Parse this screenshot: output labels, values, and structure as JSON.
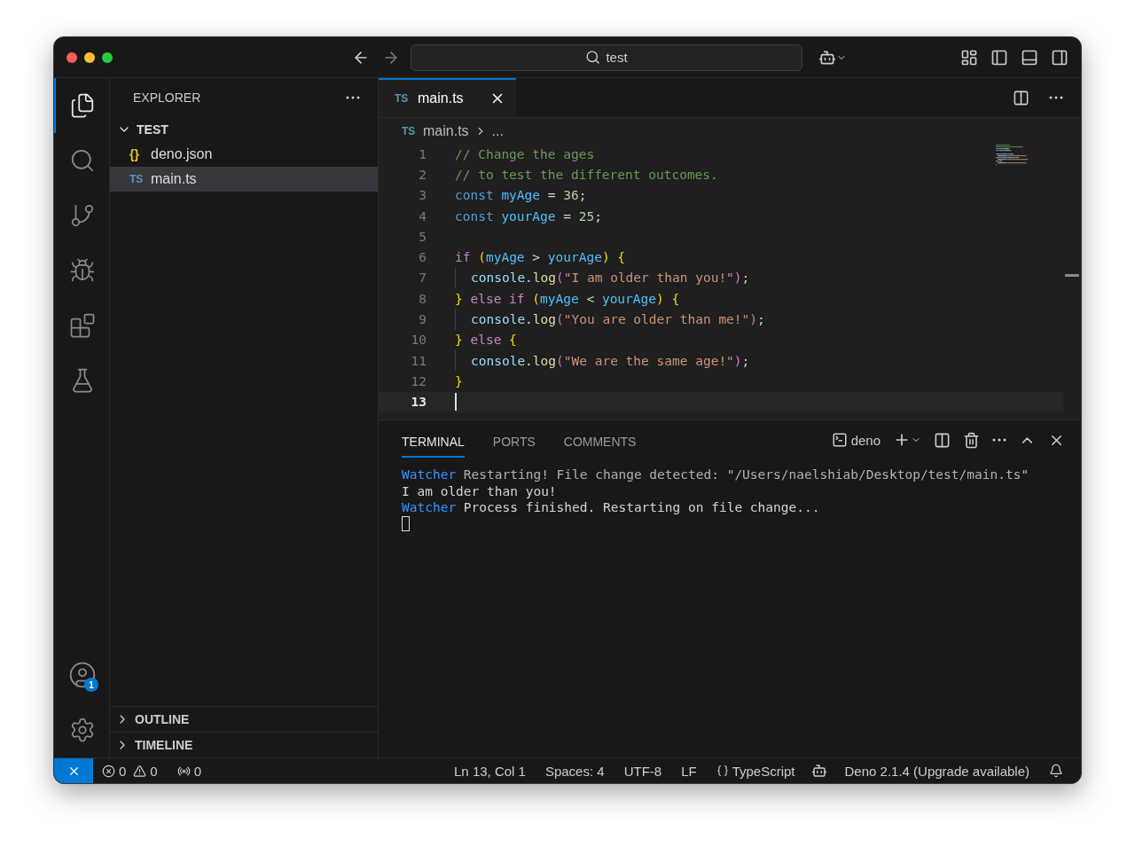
{
  "titlebar": {
    "search": "test"
  },
  "activity_bar": {
    "items": [
      {
        "kind": "files",
        "selected": true
      },
      {
        "kind": "search",
        "selected": false
      },
      {
        "kind": "source-control",
        "selected": false
      },
      {
        "kind": "run-debug",
        "selected": false
      },
      {
        "kind": "extensions",
        "selected": false
      },
      {
        "kind": "testing",
        "selected": false
      }
    ],
    "account_badge": "1"
  },
  "sidebar": {
    "title": "EXPLORER",
    "folder": {
      "name": "TEST",
      "expanded": true,
      "children": [
        {
          "name": "deno.json",
          "kind": "json",
          "icon_text": "{}",
          "selected": false
        },
        {
          "name": "main.ts",
          "kind": "ts",
          "icon_text": "TS",
          "selected": true
        }
      ]
    },
    "sections": [
      {
        "name": "OUTLINE",
        "expanded": false
      },
      {
        "name": "TIMELINE",
        "expanded": false
      }
    ]
  },
  "editor": {
    "tabs": [
      {
        "label": "main.ts",
        "icon_text": "TS",
        "selected": true
      }
    ],
    "breadcrumb": {
      "icon_text": "TS",
      "file": "main.ts",
      "rest": "..."
    },
    "lines": [
      {
        "number": "1",
        "indent": false,
        "current": false,
        "tokens": [
          {
            "kind": "comment",
            "text": "// Change the ages"
          }
        ]
      },
      {
        "number": "2",
        "indent": false,
        "current": false,
        "tokens": [
          {
            "kind": "comment",
            "text": "// to test the different outcomes."
          }
        ]
      },
      {
        "number": "3",
        "indent": false,
        "current": false,
        "tokens": [
          {
            "kind": "keyword",
            "text": "const"
          },
          {
            "kind": "variable",
            "text": " myAge"
          },
          {
            "kind": "plain",
            "text": " = "
          },
          {
            "kind": "number",
            "text": "36"
          },
          {
            "kind": "plain",
            "text": ";"
          }
        ]
      },
      {
        "number": "4",
        "indent": false,
        "current": false,
        "tokens": [
          {
            "kind": "keyword",
            "text": "const"
          },
          {
            "kind": "variable",
            "text": " yourAge"
          },
          {
            "kind": "plain",
            "text": " = "
          },
          {
            "kind": "number",
            "text": "25"
          },
          {
            "kind": "plain",
            "text": ";"
          }
        ]
      },
      {
        "number": "5",
        "indent": false,
        "current": false
      },
      {
        "number": "6",
        "indent": false,
        "current": false,
        "tokens": [
          {
            "kind": "control",
            "text": "if"
          },
          {
            "kind": "bracket",
            "text": " ("
          },
          {
            "kind": "variable",
            "text": "myAge"
          },
          {
            "kind": "plain",
            "text": " > "
          },
          {
            "kind": "variable",
            "text": "yourAge"
          },
          {
            "kind": "bracket",
            "text": ")"
          },
          {
            "kind": "bracket",
            "text": " {"
          }
        ]
      },
      {
        "number": "7",
        "indent": true,
        "current": false,
        "tokens": [
          {
            "kind": "object",
            "text": "console"
          },
          {
            "kind": "plain",
            "text": "."
          },
          {
            "kind": "function",
            "text": "log"
          },
          {
            "kind": "bracket2",
            "text": "("
          },
          {
            "kind": "string",
            "text": "\"I am older than you!\""
          },
          {
            "kind": "bracket2",
            "text": ")"
          },
          {
            "kind": "plain",
            "text": ";"
          }
        ]
      },
      {
        "number": "8",
        "indent": false,
        "current": false,
        "tokens": [
          {
            "kind": "bracket",
            "text": "}"
          },
          {
            "kind": "control",
            "text": " else if"
          },
          {
            "kind": "bracket",
            "text": " ("
          },
          {
            "kind": "variable",
            "text": "myAge"
          },
          {
            "kind": "plain",
            "text": " < "
          },
          {
            "kind": "variable",
            "text": "yourAge"
          },
          {
            "kind": "bracket",
            "text": ")"
          },
          {
            "kind": "bracket",
            "text": " {"
          }
        ]
      },
      {
        "number": "9",
        "indent": true,
        "current": false,
        "tokens": [
          {
            "kind": "object",
            "text": "console"
          },
          {
            "kind": "plain",
            "text": "."
          },
          {
            "kind": "function",
            "text": "log"
          },
          {
            "kind": "bracket2",
            "text": "("
          },
          {
            "kind": "string",
            "text": "\"You are older than me!\""
          },
          {
            "kind": "bracket2",
            "text": ")"
          },
          {
            "kind": "plain",
            "text": ";"
          }
        ]
      },
      {
        "number": "10",
        "indent": false,
        "current": false,
        "tokens": [
          {
            "kind": "bracket",
            "text": "}"
          },
          {
            "kind": "control",
            "text": " else"
          },
          {
            "kind": "bracket",
            "text": " {"
          }
        ]
      },
      {
        "number": "11",
        "indent": true,
        "current": false,
        "tokens": [
          {
            "kind": "object",
            "text": "console"
          },
          {
            "kind": "plain",
            "text": "."
          },
          {
            "kind": "function",
            "text": "log"
          },
          {
            "kind": "bracket2",
            "text": "("
          },
          {
            "kind": "string",
            "text": "\"We are the same age!\""
          },
          {
            "kind": "bracket2",
            "text": ")"
          },
          {
            "kind": "plain",
            "text": ";"
          }
        ]
      },
      {
        "number": "12",
        "indent": false,
        "current": false,
        "tokens": [
          {
            "kind": "bracket",
            "text": "}"
          }
        ]
      },
      {
        "number": "13",
        "indent": false,
        "current": true
      }
    ]
  },
  "panel": {
    "tabs": [
      {
        "label": "TERMINAL",
        "selected": true
      },
      {
        "label": "PORTS",
        "selected": false
      },
      {
        "label": "COMMENTS",
        "selected": false
      }
    ],
    "terminal_name": "deno",
    "lines": [
      [
        {
          "kind": "label",
          "text": "Watcher"
        },
        {
          "kind": "dim",
          "text": " Restarting! File change detected: \"/Users/naelshiab/Desktop/test/main.ts\""
        }
      ],
      [
        {
          "kind": "plain",
          "text": "I am older than you!"
        }
      ],
      [
        {
          "kind": "label",
          "text": "Watcher"
        },
        {
          "kind": "plain",
          "text": " Process finished. Restarting on file change..."
        }
      ]
    ]
  },
  "status_bar": {
    "errors": "0",
    "warnings": "0",
    "ports": "0",
    "items": [
      "Ln 13, Col 1",
      "Spaces: 4",
      "UTF-8",
      "LF"
    ],
    "language": "TypeScript",
    "runtime": "Deno 2.1.4 (Upgrade available)"
  }
}
